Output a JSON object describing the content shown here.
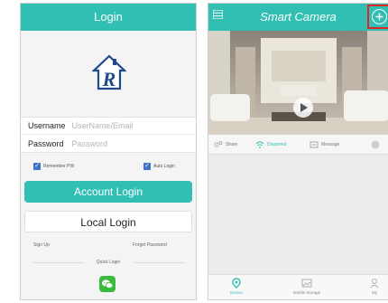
{
  "login": {
    "title": "Login",
    "username_label": "Username",
    "username_placeholder": "UserName/Email",
    "password_label": "Password",
    "password_placeholder": "Password",
    "remember_label": "Remember PW",
    "auto_login_label": "Auto Login",
    "account_login_label": "Account Login",
    "local_login_label": "Local Login",
    "sign_up_label": "Sign Up",
    "forget_password_label": "Forget Password",
    "quick_login_label": "Quick Login"
  },
  "camera": {
    "title": "Smart Camera",
    "actions": {
      "share": "Share",
      "unarmed": "Disarmed",
      "message": "Message"
    },
    "nav": {
      "device": "Device",
      "mobile_storage": "Mobile Storage",
      "my": "My"
    }
  },
  "colors": {
    "accent": "#31bfb3",
    "highlight": "#e02525",
    "wechat": "#3bba3e"
  },
  "icons": [
    "house-r-logo-icon",
    "check-icon",
    "wechat-icon",
    "menu-icon",
    "add-circle-icon",
    "play-icon",
    "share-icon",
    "shield-icon",
    "message-icon",
    "gear-icon",
    "location-pin-icon",
    "image-icon",
    "person-icon"
  ]
}
